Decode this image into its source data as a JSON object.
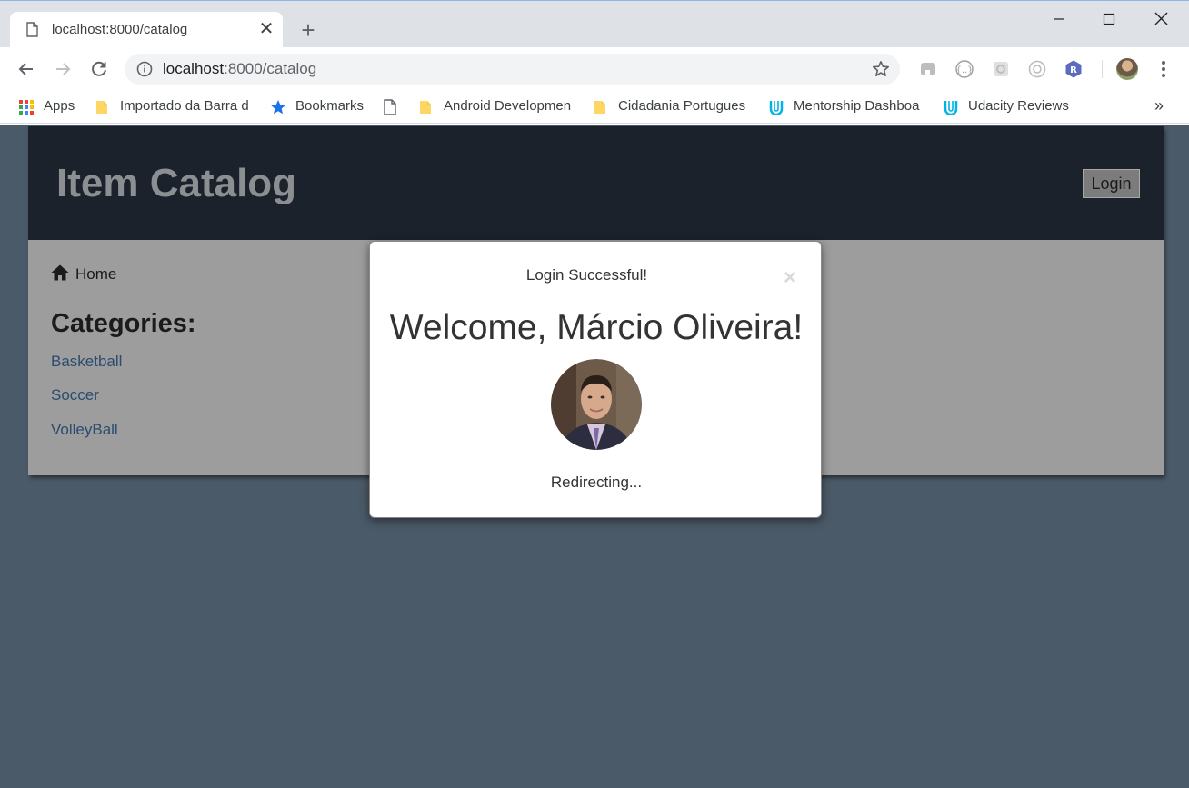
{
  "browser": {
    "tab": {
      "title": "localhost:8000/catalog",
      "close_glyph": "✕"
    },
    "new_tab_glyph": "+",
    "address": {
      "host": "localhost",
      "rest": ":8000/catalog"
    },
    "bookmarks": [
      {
        "label": "Apps",
        "icon": "apps-grid-icon"
      },
      {
        "label": "Importado da Barra d",
        "icon": "folder-icon"
      },
      {
        "label": "Bookmarks",
        "icon": "star-icon"
      },
      {
        "label": "",
        "icon": "page-icon"
      },
      {
        "label": "Android Developmen",
        "icon": "folder-icon"
      },
      {
        "label": "Cidadania Portugues",
        "icon": "folder-icon"
      },
      {
        "label": "Mentorship Dashboa",
        "icon": "udacity-icon"
      },
      {
        "label": "Udacity Reviews",
        "icon": "udacity-icon"
      }
    ],
    "more_glyph": "»",
    "extension_badge": "R",
    "colors": {
      "tabstrip": "#dee1e6",
      "omnibox": "#f1f3f4",
      "folder": "#fdd663",
      "udacity": "#02b3e4",
      "ext_badge": "#5c6bc0"
    }
  },
  "app": {
    "title": "Item Catalog",
    "login_label": "Login",
    "home_label": "Home",
    "categories_heading": "Categories:",
    "categories": [
      "Basketball",
      "Soccer",
      "VolleyBall"
    ],
    "colors": {
      "header_bg": "#1b222c",
      "body_bg": "#9d9d9d",
      "link": "#2b4c6e",
      "page_bg": "#4b5a68"
    }
  },
  "modal": {
    "title": "Login Successful!",
    "close_glyph": "×",
    "welcome": "Welcome, Márcio Oliveira!",
    "status": "Redirecting..."
  }
}
